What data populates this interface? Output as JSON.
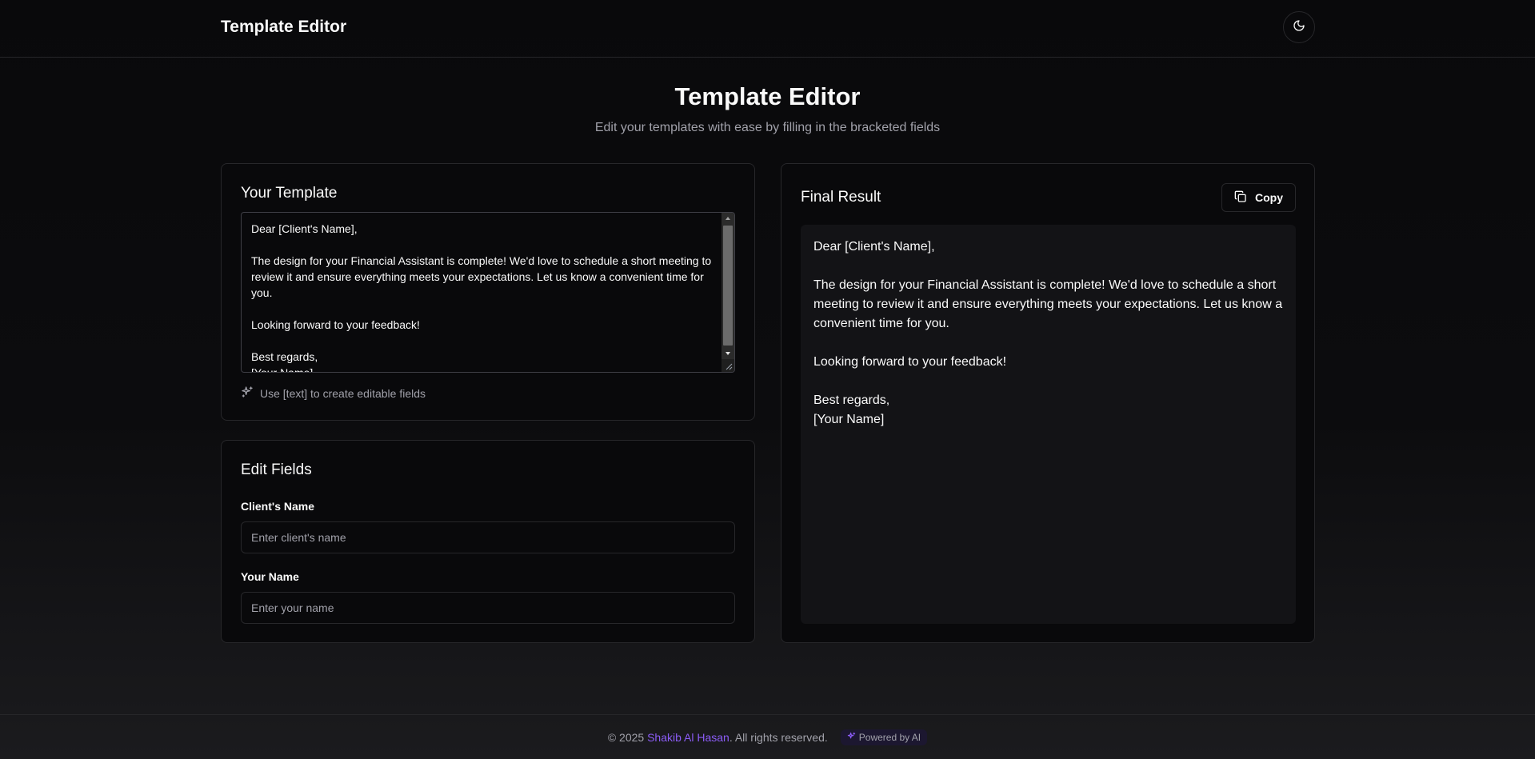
{
  "header": {
    "title": "Template Editor",
    "theme_toggle_icon": "moon-icon"
  },
  "hero": {
    "title": "Template Editor",
    "subtitle": "Edit your templates with ease by filling in the bracketed fields"
  },
  "template_card": {
    "title": "Your Template",
    "text": "Dear [Client's Name],\n\nThe design for your Financial Assistant is complete! We'd love to schedule a short meeting to review it and ensure everything meets your expectations. Let us know a convenient time for you.\n\nLooking forward to your feedback!\n\nBest regards,\n[Your Name]",
    "hint": "Use [text] to create editable fields",
    "hint_icon": "sparkles-icon"
  },
  "fields_card": {
    "title": "Edit Fields",
    "fields": [
      {
        "label": "Client's Name",
        "value": "",
        "placeholder": "Enter client's name"
      },
      {
        "label": "Your Name",
        "value": "",
        "placeholder": "Enter your name"
      }
    ]
  },
  "result_card": {
    "title": "Final Result",
    "copy_label": "Copy",
    "copy_icon": "copy-icon",
    "text": "Dear [Client's Name],\n\nThe design for your Financial Assistant is complete! We'd love to schedule a short meeting to review it and ensure everything meets your expectations. Let us know a convenient time for you.\n\nLooking forward to your feedback!\n\nBest regards,\n[Your Name]"
  },
  "footer": {
    "copyright": "© 2025",
    "author": "Shakib Al Hasan",
    "rights": ". All rights reserved.",
    "badge": "Powered by AI"
  },
  "colors": {
    "background": "#09090b",
    "border": "#27272a",
    "muted_text": "#a1a1aa",
    "accent": "#8b5cf6"
  }
}
